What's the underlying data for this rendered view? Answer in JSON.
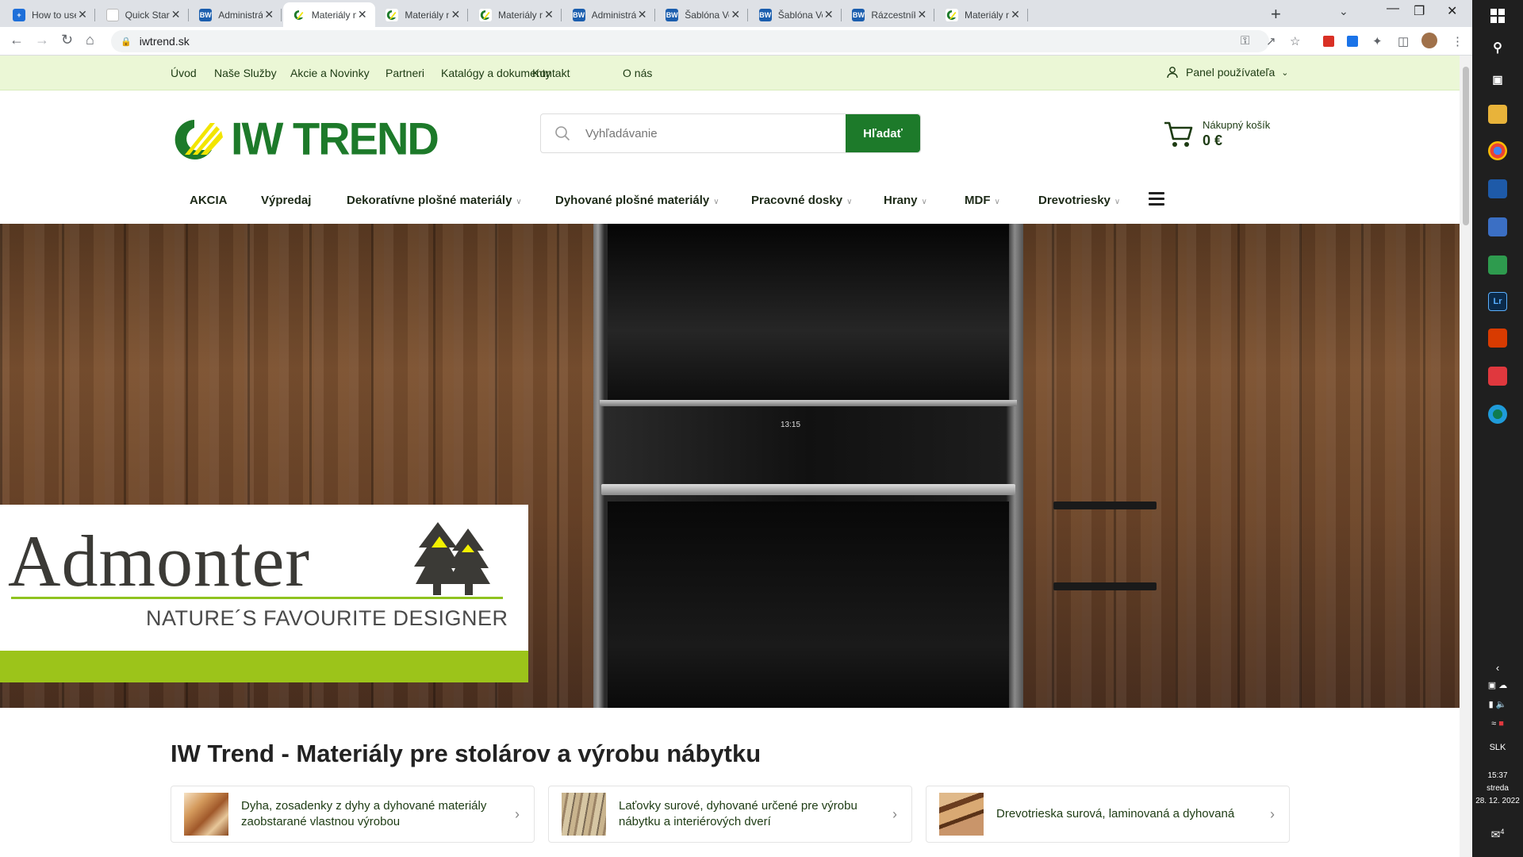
{
  "browser": {
    "tabs": [
      {
        "title": "How to use Mi",
        "favicon": "ms"
      },
      {
        "title": "Quick Start Gu",
        "favicon": "doc"
      },
      {
        "title": "Administrácia",
        "favicon": "bw"
      },
      {
        "title": "Materiály na vý",
        "favicon": "iw",
        "active": true
      },
      {
        "title": "Materiály na vý",
        "favicon": "iw"
      },
      {
        "title": "Materiály na vý",
        "favicon": "iw"
      },
      {
        "title": "Administrácia",
        "favicon": "bw"
      },
      {
        "title": "Šablóna Veron",
        "favicon": "bw"
      },
      {
        "title": "Šablóna Veron",
        "favicon": "bw"
      },
      {
        "title": "Rázcestník v pr",
        "favicon": "bw"
      },
      {
        "title": "Materiály na vý",
        "favicon": "iw"
      }
    ],
    "url": "iwtrend.sk",
    "new_tab": "+"
  },
  "site": {
    "top_nav": [
      "Úvod",
      "Naše Služby",
      "Akcie a Novinky",
      "Partneri",
      "Katalógy a dokumenty",
      "Kontakt",
      "O nás"
    ],
    "user_panel": "Panel používateľa",
    "logo_text": "IW TREND",
    "search_placeholder": "Vyhľadávanie",
    "search_button": "Hľadať",
    "cart_label": "Nákupný košík",
    "cart_amount": "0 €",
    "main_nav": [
      {
        "label": "AKCIA",
        "dropdown": false
      },
      {
        "label": "Výpredaj",
        "dropdown": false
      },
      {
        "label": "Dekoratívne plošné materiály",
        "dropdown": true
      },
      {
        "label": "Dyhované plošné materiály",
        "dropdown": true
      },
      {
        "label": "Pracovné dosky",
        "dropdown": true
      },
      {
        "label": "Hrany",
        "dropdown": true
      },
      {
        "label": "MDF",
        "dropdown": true
      },
      {
        "label": "Drevotriesky",
        "dropdown": true
      }
    ],
    "hero": {
      "brand": "Admonter",
      "slogan": "NATURE´S FAVOURITE DESIGNER",
      "oven_clock": "13:15"
    },
    "headline": "IW Trend - Materiály pre stolárov a výrobu nábytku",
    "cards": [
      {
        "text": "Dyha, zosadenky z dyhy a dyhované materiály zaobstarané vlastnou výrobou"
      },
      {
        "text": "Laťovky surové, dyhované určené pre výrobu nábytku a interiérových dverí"
      },
      {
        "text": "Drevotrieska surová, laminovaná a dyhovaná"
      }
    ]
  },
  "taskbar": {
    "language": "SLK",
    "time": "15:37",
    "day": "streda",
    "date": "28. 12. 2022",
    "notifications": "4"
  },
  "colors": {
    "brand_green": "#1d7a2a",
    "topbar_bg": "#ebf7d6",
    "admonter_green": "#9cc41a"
  }
}
